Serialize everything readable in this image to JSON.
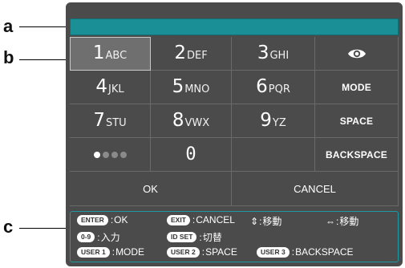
{
  "callouts": {
    "a": "a",
    "b": "b",
    "c": "c"
  },
  "input": {
    "value": ""
  },
  "keys": {
    "k1": {
      "digit": "1",
      "letters": "ABC"
    },
    "k2": {
      "digit": "2",
      "letters": "DEF"
    },
    "k3": {
      "digit": "3",
      "letters": "GHI"
    },
    "k4": {
      "digit": "4",
      "letters": "JKL"
    },
    "k5": {
      "digit": "5",
      "letters": "MNO"
    },
    "k6": {
      "digit": "6",
      "letters": "PQR"
    },
    "k7": {
      "digit": "7",
      "letters": "STU"
    },
    "k8": {
      "digit": "8",
      "letters": "VWX"
    },
    "k9": {
      "digit": "9",
      "letters": "YZ"
    },
    "k0": {
      "digit": "0"
    },
    "mode": "MODE",
    "space": "SPACE",
    "backspace": "BACKSPACE",
    "ok": "OK",
    "cancel": "CANCEL",
    "eye_icon": "eye-icon",
    "mask_dots_filled": 1,
    "mask_dots_total": 4
  },
  "guide": {
    "enter_pill": "ENTER",
    "enter_text": "OK",
    "exit_pill": "EXIT",
    "exit_text": "CANCEL",
    "updown_text": "移動",
    "leftright_text": "移動",
    "digits_pill": "0-9",
    "digits_text": "入力",
    "idset_pill": "ID SET",
    "idset_text": "切替",
    "user1_pill": "USER 1",
    "user1_text": "MODE",
    "user2_pill": "USER 2",
    "user2_text": "SPACE",
    "user3_pill": "USER 3",
    "user3_text": "BACKSPACE",
    "colon": ":"
  },
  "colors": {
    "panel": "#4b4b4b",
    "accent": "#1a8f96",
    "guide_border": "#1f9aa2"
  }
}
